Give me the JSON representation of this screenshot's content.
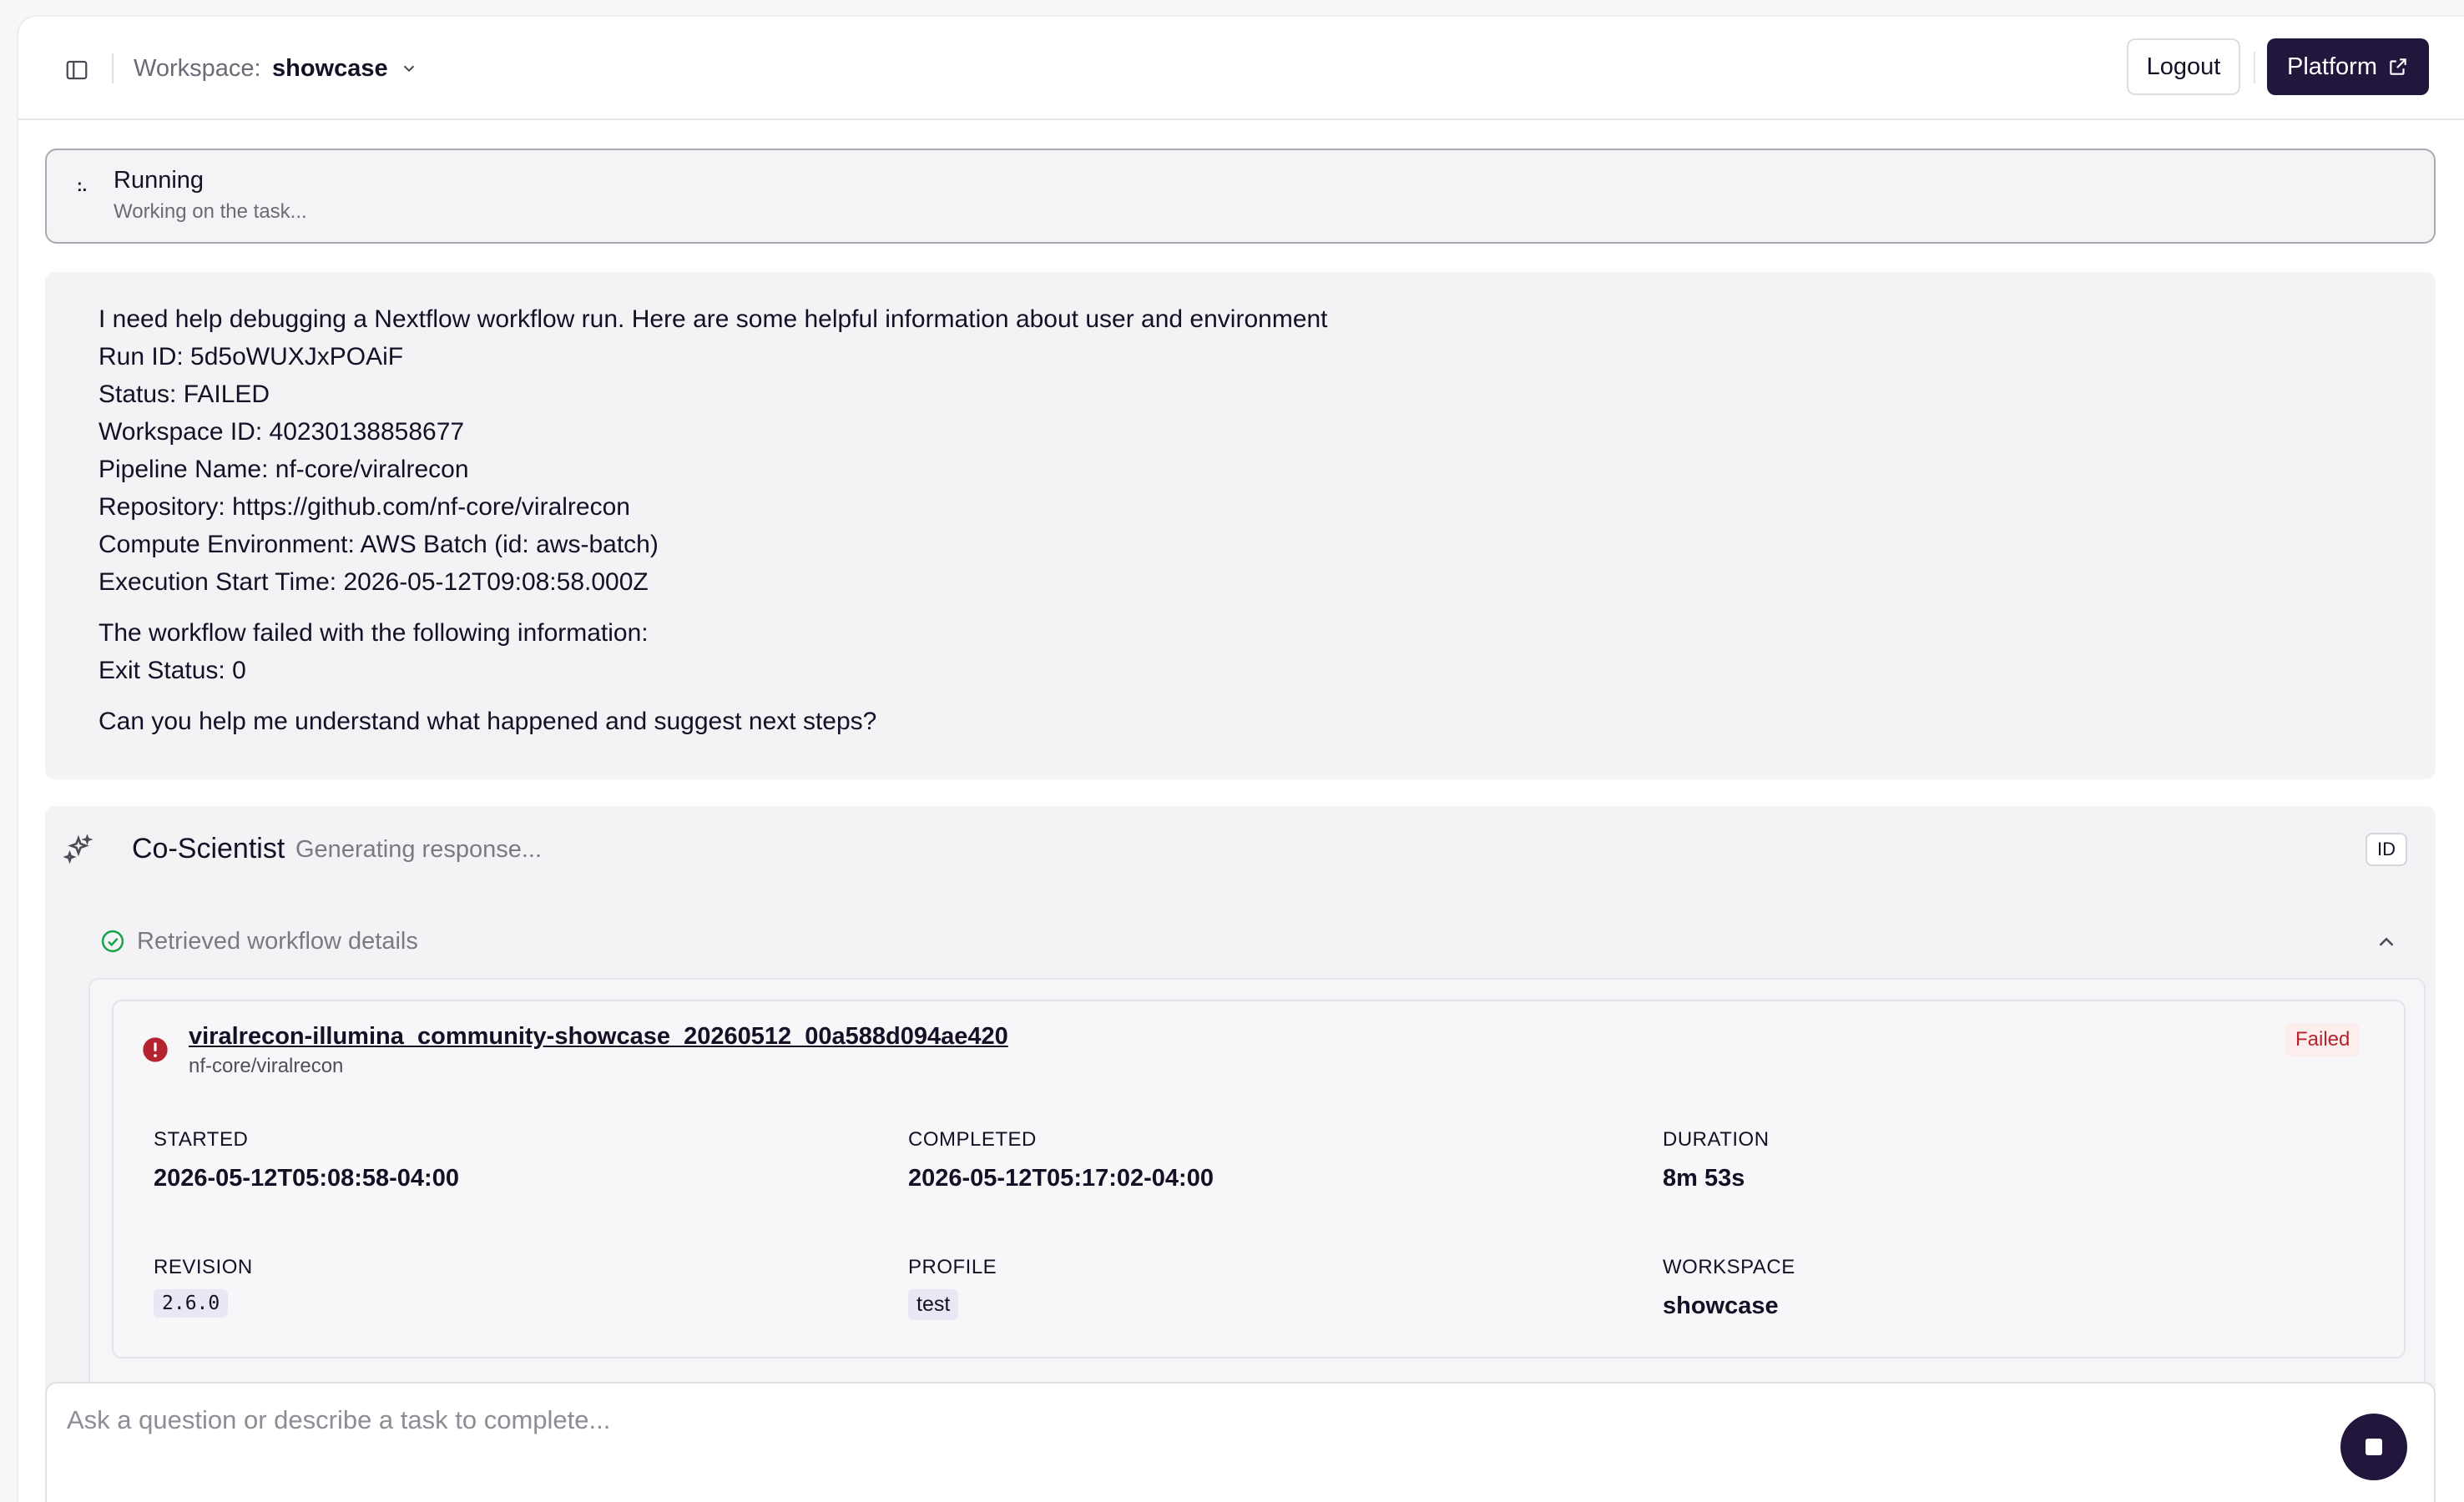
{
  "header": {
    "workspace_label": "Workspace:",
    "workspace_value": "showcase",
    "logout_label": "Logout",
    "platform_label": "Platform"
  },
  "status": {
    "title": "Running",
    "subtitle": "Working on the task..."
  },
  "user_message": {
    "intro": "I need help debugging a Nextflow workflow run. Here are some helpful information about user and environment",
    "run_id": "Run ID: 5d5oWUXJxPOAiF",
    "status_line": "Status: FAILED",
    "workspace_id": "Workspace ID: 40230138858677",
    "pipeline_name": "Pipeline Name: nf-core/viralrecon",
    "repository_label": "Repository: ",
    "repository_url": "https://github.com/nf-core/viralrecon",
    "compute_env": "Compute Environment: AWS Batch (id: aws-batch)",
    "start_time": "Execution Start Time: 2026-05-12T09:08:58.000Z",
    "failure_intro": "The workflow failed with the following information:",
    "exit_status": "Exit Status: 0",
    "question": "Can you help me understand what happened and suggest next steps?"
  },
  "assistant": {
    "name": "Co-Scientist",
    "state": "Generating response...",
    "id_badge": "ID",
    "tool_label": "Retrieved workflow details",
    "run": {
      "name": "viralrecon-illumina_community-showcase_20260512_00a588d094ae420",
      "repo": "nf-core/viralrecon",
      "status": "Failed",
      "started_label": "STARTED",
      "started_value": "2026-05-12T05:08:58-04:00",
      "completed_label": "COMPLETED",
      "completed_value": "2026-05-12T05:17:02-04:00",
      "duration_label": "DURATION",
      "duration_value": "8m 53s",
      "revision_label": "REVISION",
      "revision_value": "2.6.0",
      "profile_label": "PROFILE",
      "profile_value": "test",
      "workspace_label": "WORKSPACE",
      "workspace_value": "showcase"
    }
  },
  "composer": {
    "placeholder": "Ask a question or describe a task to complete..."
  },
  "colors": {
    "primary": "#22163d",
    "failed": "#b4232f",
    "success": "#16a34a"
  },
  "icons": [
    "sidebar-toggle-icon",
    "chevron-down-icon",
    "external-link-icon",
    "sparkles-icon",
    "check-circle-icon",
    "chevron-up-icon",
    "error-icon",
    "stop-icon"
  ]
}
